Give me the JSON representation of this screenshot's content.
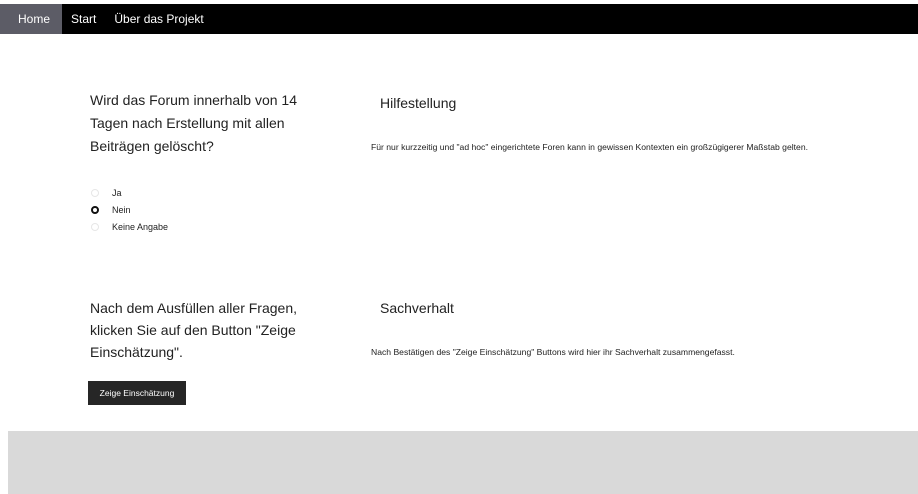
{
  "nav": {
    "items": [
      {
        "label": "Home",
        "active": true
      },
      {
        "label": "Start",
        "active": false
      },
      {
        "label": "Über das Projekt",
        "active": false
      }
    ]
  },
  "question": {
    "text": "Wird das Forum innerhalb von 14 Tagen nach Erstellung mit allen Beiträgen gelöscht?",
    "options": [
      {
        "label": "Ja",
        "checked": false
      },
      {
        "label": "Nein",
        "checked": true
      },
      {
        "label": "Keine Angabe",
        "checked": false
      }
    ]
  },
  "help": {
    "title": "Hilfestellung",
    "text": "Für nur kurzzeitig und \"ad hoc\" eingerichtete Foren kann in gewissen Kontexten ein großzügigerer Maßstab gelten."
  },
  "instructions": {
    "text": "Nach dem Ausfüllen aller Fragen, klicken Sie auf den Button \"Zeige Einschätzung\"."
  },
  "facts": {
    "title": "Sachverhalt",
    "text": "Nach Bestätigen des \"Zeige Einschätzung\" Buttons wird hier ihr Sachverhalt zusammengefasst."
  },
  "button": {
    "label": "Zeige Einschätzung"
  },
  "colors": {
    "navbar": "#000000",
    "nav_active": "#5c5c66",
    "button": "#262626",
    "footer": "#d9d9d9"
  }
}
